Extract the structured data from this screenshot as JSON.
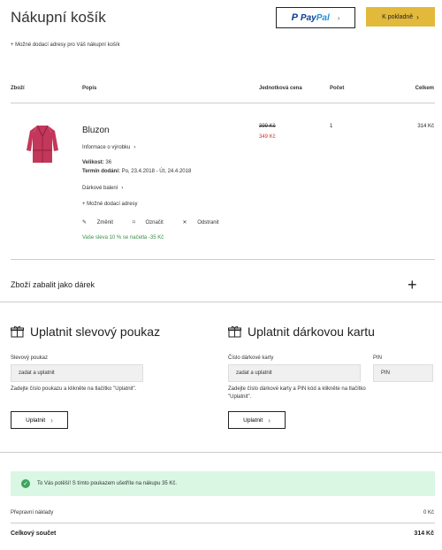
{
  "page": {
    "title": "Nákupní košík"
  },
  "header": {
    "paypal_brand_a": "Pay",
    "paypal_brand_b": "Pal",
    "checkout_label": "K pokladně",
    "address_link": "Možné dodací adresy pro Váš nákupní košík"
  },
  "table": {
    "columns": {
      "goods": "Zboží",
      "description": "Popis",
      "unit_price": "Jednotková cena",
      "count": "Počet",
      "total": "Celkem"
    }
  },
  "item": {
    "name": "Bluzon",
    "info_link": "Informace o výrobku",
    "size_label": "Velikost:",
    "size_value": "36",
    "delivery_label": "Termín dodání:",
    "delivery_value": "Po, 23.4.2018 - Út, 24.4.2018",
    "gift_wrap": "Dárkové balení",
    "delivery_address": "Možné dodací adresy",
    "change": "Změnit",
    "mark": "Označit",
    "remove": "Odstranit",
    "discount_note": "Vaše sleva 10 % se načetla -35 Kč",
    "old_price": "399 Kč",
    "new_price": "349 Kč",
    "quantity": "1",
    "total": "314 Kč"
  },
  "wrap_gift": {
    "label": "Zboží zabalit jako dárek"
  },
  "voucher": {
    "title": "Uplatnit slevový poukaz",
    "field_label": "Slevový poukaz",
    "placeholder": "zadat a uplatnit",
    "hint": "Zadejte číslo poukazu a klikněte na tlačítko \"Uplatnit\".",
    "button": "Uplatnit"
  },
  "giftcard": {
    "title": "Uplatnit dárkovou kartu",
    "field_label": "Číslo dárkové karty",
    "placeholder": "zadat a uplatnit",
    "pin_label": "PIN",
    "pin_placeholder": "PIN",
    "hint": "Zadejte číslo dárkové karty a PIN kód a klikněte na tlačítko \"Uplatnit\".",
    "button": "Uplatnit"
  },
  "success_message": "To Vás potěší! S tímto poukazem ušetříte na nákupu 35 Kč.",
  "summary": {
    "shipping_label": "Přepravní náklady",
    "shipping_value": "0 Kč",
    "total_label": "Celkový součet",
    "total_value": "314 Kč"
  },
  "colors": {
    "accent": "#e2b93b",
    "sale": "#d0332e",
    "success_bg": "#d9f7e3",
    "success_text": "#3a8f4a"
  }
}
